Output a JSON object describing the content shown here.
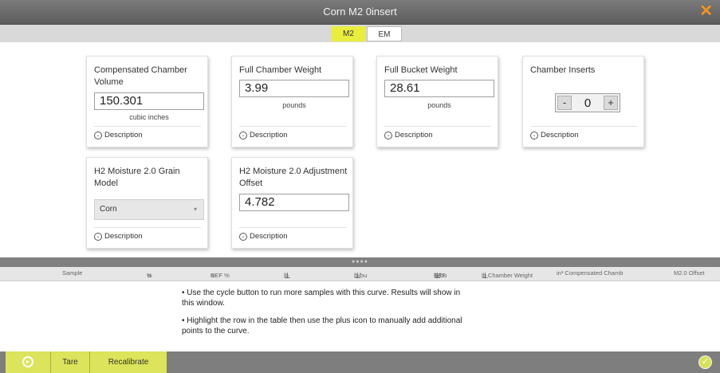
{
  "window": {
    "title": "Corn M2 0insert",
    "close_glyph": "✕"
  },
  "tabs": [
    {
      "label": "M2",
      "active": true
    },
    {
      "label": "EM",
      "active": false
    }
  ],
  "cards": {
    "compensated": {
      "title": "Compensated Chamber Volume",
      "value": "150.301",
      "unit": "cubic inches",
      "description": "Description"
    },
    "full_chamber": {
      "title": "Full Chamber Weight",
      "value": "3.99",
      "unit": "pounds",
      "description": "Description"
    },
    "full_bucket": {
      "title": "Full Bucket Weight",
      "value": "28.61",
      "unit": "pounds",
      "description": "Description"
    },
    "inserts": {
      "title": "Chamber Inserts",
      "value": "0",
      "minus": "-",
      "plus": "+",
      "description": "Description"
    },
    "grain_model": {
      "title": "H2 Moisture 2.0 Grain Model",
      "selected": "Corn",
      "description": "Description"
    },
    "adjustment": {
      "title": "H2 Moisture 2.0 Adjustment Offset",
      "value": "4.782",
      "description": "Description"
    }
  },
  "icons": {
    "description": "chevron-circle-icon",
    "drop": "drop-icon",
    "weight": "scale-icon",
    "cycle": "cycle-icon",
    "ok": "check-circle-icon"
  },
  "columns": {
    "sample": "Sample",
    "pct": "%",
    "ref_pct": "REF %",
    "lb": "lb",
    "lbbu": "lb/bu",
    "ref_lbbu": "REF",
    "ref_lbbu_unit": "lb/bu",
    "chamber_weight": "lb Chamber Weight",
    "compensated": "in³ Compensated Chamb",
    "offset": "M2.0 Offset"
  },
  "notes": [
    "Use the cycle button to run more samples with this curve. Results will show in this window.",
    "Highlight the row in the table then use the plus icon to manually add additional points to the curve."
  ],
  "footer": {
    "tare": "Tare",
    "recalibrate": "Recalibrate"
  },
  "colors": {
    "accent": "#e9ee3d",
    "close": "#f7941d",
    "footer_btn": "#dbe45a"
  }
}
